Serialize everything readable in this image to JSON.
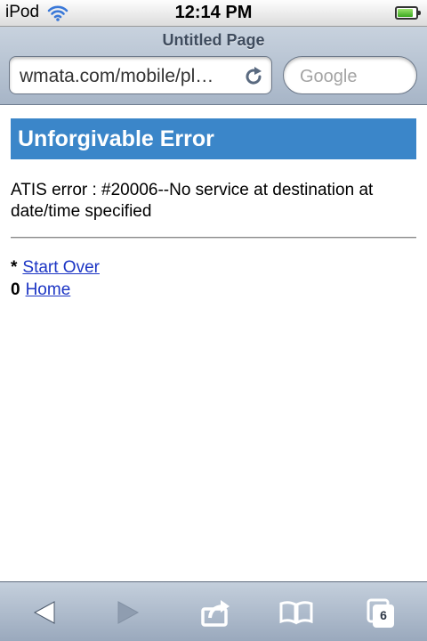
{
  "status_bar": {
    "carrier": "iPod",
    "time": "12:14 PM",
    "icons": [
      "wifi-icon",
      "battery-icon"
    ],
    "battery_level": 0.85,
    "battery_color": "#4cbb2a"
  },
  "browser": {
    "page_title": "Untitled Page",
    "url": "wmata.com/mobile/pl…",
    "search_placeholder": "Google",
    "reload_icon": "reload-icon"
  },
  "page": {
    "heading": "Unforgivable Error",
    "heading_color": "#3b86c9",
    "message": "ATIS error : #20006--No service at destination at date/time specified",
    "links": [
      {
        "key": "*",
        "label": "Start Over"
      },
      {
        "key": "0",
        "label": "Home"
      }
    ],
    "link_color": "#1c35c4"
  },
  "toolbar": {
    "buttons": [
      "back-icon",
      "forward-icon",
      "share-icon",
      "bookmarks-icon",
      "pages-icon"
    ],
    "pages_count": "6"
  }
}
